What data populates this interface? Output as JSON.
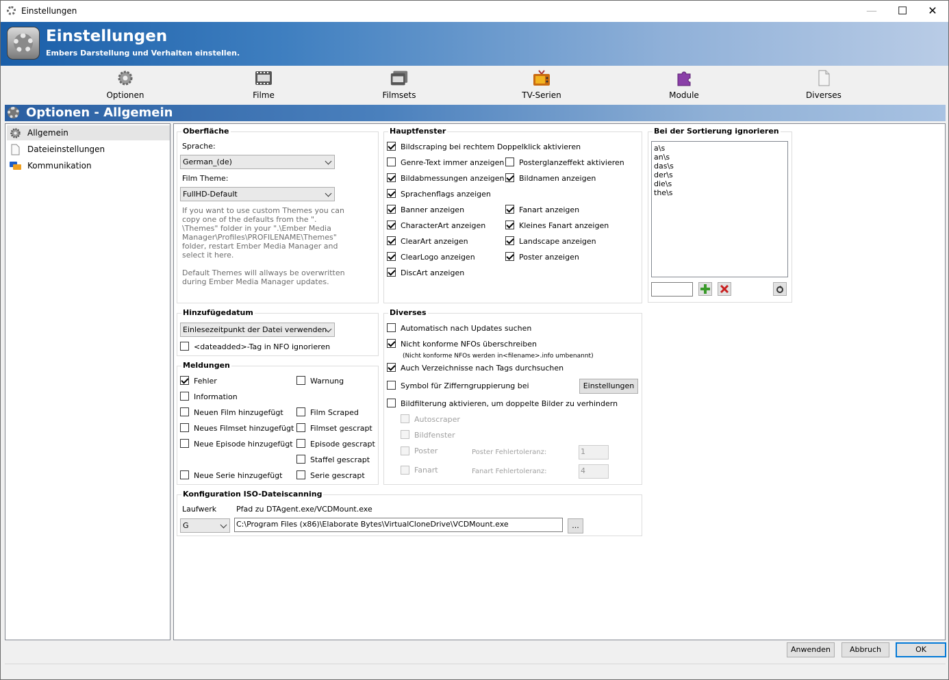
{
  "window": {
    "title": "Einstellungen"
  },
  "header": {
    "title": "Einstellungen",
    "subtitle": "Embers Darstellung und Verhalten einstellen."
  },
  "tabs": [
    {
      "label": "Optionen",
      "icon": "gear-icon"
    },
    {
      "label": "Filme",
      "icon": "film-icon"
    },
    {
      "label": "Filmsets",
      "icon": "filmsets-icon"
    },
    {
      "label": "TV-Serien",
      "icon": "tv-icon"
    },
    {
      "label": "Module",
      "icon": "puzzle-icon"
    },
    {
      "label": "Diverses",
      "icon": "document-icon"
    }
  ],
  "section": {
    "title": "Optionen - Allgemein"
  },
  "sidebar": {
    "items": [
      {
        "label": "Allgemein",
        "icon": "gear-icon",
        "selected": true
      },
      {
        "label": "Dateieinstellungen",
        "icon": "file-icon",
        "selected": false
      },
      {
        "label": "Kommunikation",
        "icon": "chat-icon",
        "selected": false
      }
    ]
  },
  "oberflaeche": {
    "title": "Oberfläche",
    "language_label": "Sprache:",
    "language_value": "German_(de)",
    "theme_label": "Film Theme:",
    "theme_value": "FullHD-Default",
    "help1": [
      "If you want to use custom Themes you can",
      "copy one of the defaults from the \".",
      "\\Themes\" folder in your \".\\Ember Media",
      "Manager\\Profiles\\PROFILENAME\\Themes\"",
      "folder, restart Ember Media Manager and",
      "select it here."
    ],
    "help2": [
      "Default Themes will allways be overwritten",
      "during Ember Media Manager updates."
    ]
  },
  "hinzufuege": {
    "title": "Hinzufügedatum",
    "mode_value": "Einlesezeitpunkt der Datei verwenden",
    "dateadded_label": "<dateadded>-Tag in NFO ignorieren",
    "dateadded_checked": false
  },
  "meldungen": {
    "title": "Meldungen",
    "fehler": "Fehler",
    "warnung": "Warnung",
    "information": "Information",
    "neuer_film": "Neuen Film hinzugefügt",
    "film_scraped": "Film Scraped",
    "neues_filmset": "Neues Filmset hinzugefügt",
    "filmset_gescrapt": "Filmset gescrapt",
    "neue_episode": "Neue Episode hinzugefügt",
    "episode_gescrapt": "Episode gescrapt",
    "staffel_gescrapt": "Staffel gescrapt",
    "neue_serie": "Neue Serie hinzugefügt",
    "serie_gescrapt": "Serie gescrapt"
  },
  "hauptfenster": {
    "title": "Hauptfenster",
    "bildscraping": "Bildscraping bei rechtem Doppelklick aktivieren",
    "genre": "Genre-Text immer anzeigen",
    "posterglanz": "Posterglanzeffekt aktivieren",
    "bildabmessungen": "Bildabmessungen anzeigen",
    "bildnamen": "Bildnamen anzeigen",
    "sprachenflags": "Sprachenflags anzeigen",
    "banner": "Banner anzeigen",
    "fanart": "Fanart anzeigen",
    "characterart": "CharacterArt anzeigen",
    "kleines_fanart": "Kleines Fanart anzeigen",
    "clearart": "ClearArt anzeigen",
    "landscape": "Landscape anzeigen",
    "clearlogo": "ClearLogo anzeigen",
    "poster": "Poster anzeigen",
    "discart": "DiscArt anzeigen"
  },
  "diverses": {
    "title": "Diverses",
    "auto_updates": "Automatisch nach Updates suchen",
    "nfo_overwrite": "Nicht konforme NFOs überschreiben",
    "nfo_note": "(Nicht konforme NFOs werden in<filename>.info umbenannt)",
    "tags": "Auch Verzeichnisse nach Tags durchsuchen",
    "ziffern": "Symbol für Zifferngruppierung bei",
    "einstellungen_button": "Einstellungen",
    "bildfilter": "Bildfilterung aktivieren, um doppelte Bilder zu verhindern",
    "autoscraper": "Autoscraper",
    "bildfenster": "Bildfenster",
    "poster": "Poster",
    "poster_tol_label": "Poster Fehlertoleranz:",
    "poster_tol_value": "1",
    "fanart": "Fanart",
    "fanart_tol_label": "Fanart Fehlertoleranz:",
    "fanart_tol_value": "4"
  },
  "sortierung": {
    "title": "Bei der Sortierung ignorieren",
    "items": [
      "a\\s",
      "an\\s",
      "das\\s",
      "der\\s",
      "die\\s",
      "the\\s"
    ],
    "input_value": ""
  },
  "iso": {
    "title": "Konfiguration ISO-Dateiscanning",
    "drive_label": "Laufwerk",
    "path_label": "Pfad zu DTAgent.exe/VCDMount.exe",
    "drive_value": "G",
    "path_value": "C:\\Program Files (x86)\\Elaborate Bytes\\VirtualCloneDrive\\VCDMount.exe",
    "browse_label": "..."
  },
  "footer": {
    "apply": "Anwenden",
    "cancel": "Abbruch",
    "ok": "OK"
  },
  "colors": {
    "accent": "#0078d7",
    "header_start": "#1a5ea8",
    "header_end": "#b9cce6"
  }
}
